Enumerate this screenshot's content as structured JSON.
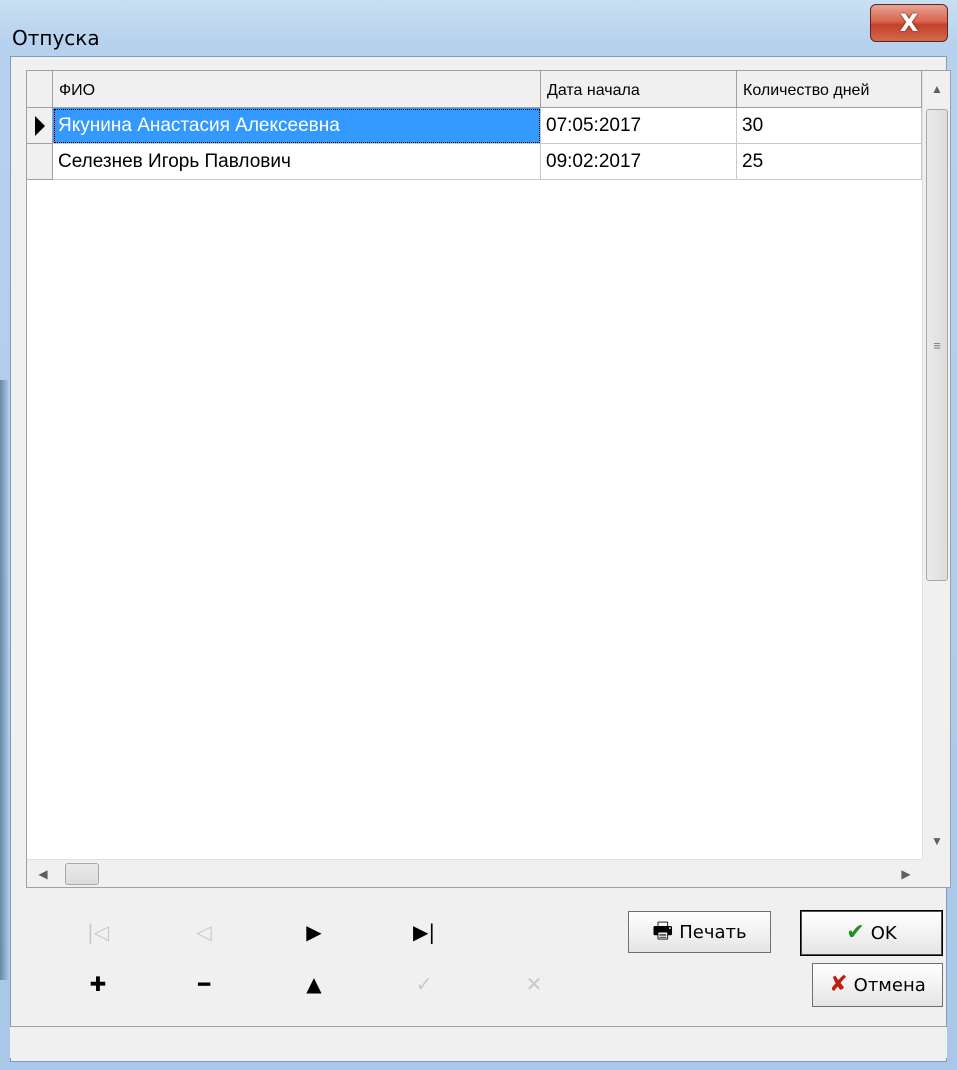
{
  "window": {
    "title": "Отпуска",
    "close_glyph": "X"
  },
  "grid": {
    "columns": [
      "ФИО",
      "Дата начала",
      "Количество дней"
    ],
    "rows": [
      {
        "name": "Якунина Анастасия Алексеевна",
        "start_date": "07:05:2017",
        "days": "30",
        "selected": true
      },
      {
        "name": "Селезнев Игорь Павлович",
        "start_date": "09:02:2017",
        "days": "25",
        "selected": false
      }
    ]
  },
  "navigator": {
    "buttons": [
      {
        "name": "first-record",
        "glyph": "|◁",
        "enabled": false
      },
      {
        "name": "prior-record",
        "glyph": "◁",
        "enabled": false
      },
      {
        "name": "next-record",
        "glyph": "▶",
        "enabled": true
      },
      {
        "name": "last-record",
        "glyph": "▶|",
        "enabled": true
      },
      {
        "name": "insert-record",
        "glyph": "✚",
        "enabled": true
      },
      {
        "name": "delete-record",
        "glyph": "━",
        "enabled": true
      },
      {
        "name": "edit-record",
        "glyph": "▲",
        "enabled": true
      },
      {
        "name": "post-record",
        "glyph": "✓",
        "enabled": false
      },
      {
        "name": "cancel-record",
        "glyph": "✕",
        "enabled": false
      }
    ]
  },
  "buttons": {
    "print": "Печать",
    "ok": "OK",
    "cancel": "Отмена"
  },
  "colors": {
    "selection": "#3399ff",
    "ok_check": "#1f8f1f",
    "cancel_x": "#c02010"
  },
  "icons": {
    "print": "printer-icon",
    "ok": "checkmark-icon",
    "cancel": "red-x-icon"
  }
}
